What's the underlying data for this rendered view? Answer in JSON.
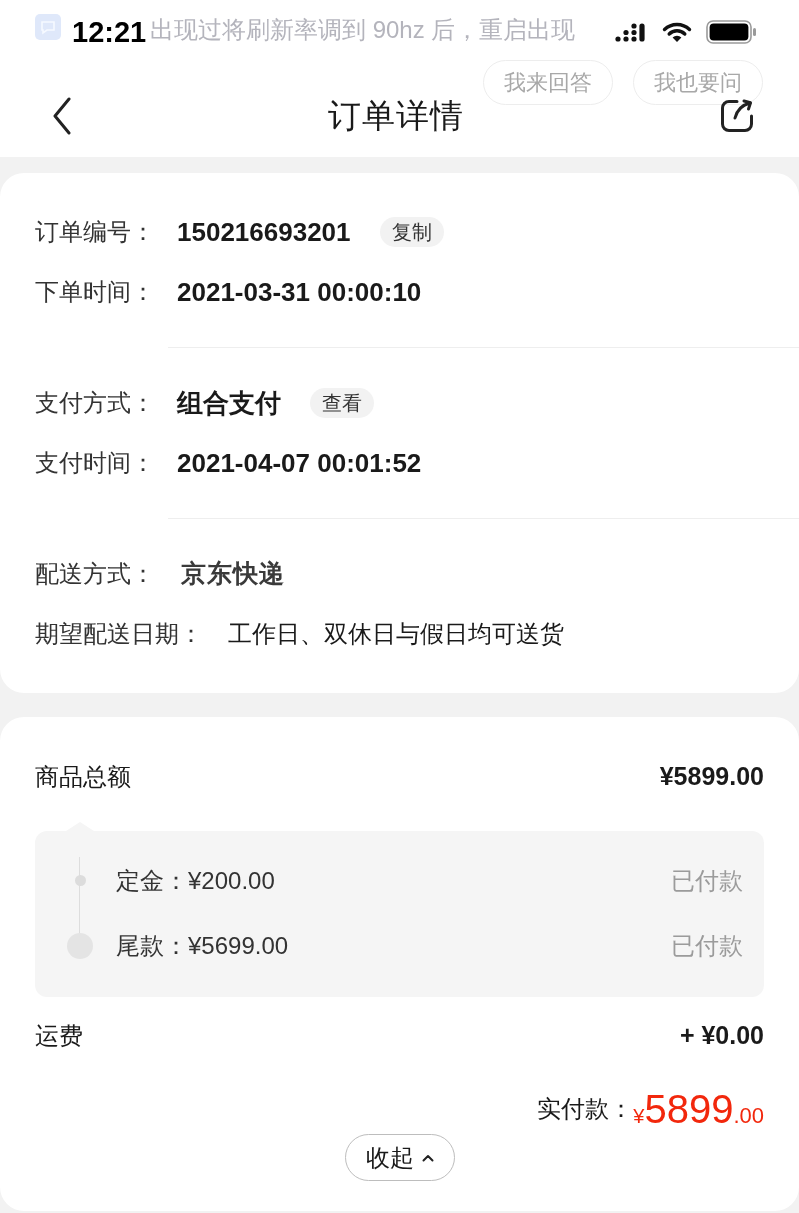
{
  "status_bar": {
    "time": "12:21"
  },
  "background_layer": {
    "notification": "出现过将刷新率调到 90hz 后，重启出现",
    "buttons": [
      "我来回答",
      "我也要问"
    ]
  },
  "nav_bar": {
    "title": "订单详情"
  },
  "order_card": {
    "groups": [
      {
        "rows": [
          {
            "label": "订单编号：",
            "value": "150216693201",
            "kind": "emphasis",
            "action": "复制"
          },
          {
            "label": "下单时间：",
            "value": "2021-03-31 00:00:10",
            "kind": "emphasis"
          }
        ]
      },
      {
        "rows": [
          {
            "label": "支付方式：",
            "value": "组合支付",
            "kind": "emphasis",
            "action": "查看"
          },
          {
            "label": "支付时间：",
            "value": "2021-04-07 00:01:52",
            "kind": "emphasis"
          }
        ]
      },
      {
        "rows": [
          {
            "label": "配送方式：",
            "value": "京东快递",
            "kind": "logo"
          },
          {
            "label": "期望配送日期：",
            "value": "工作日、双休日与假日均可送货",
            "kind": "plain"
          }
        ]
      }
    ]
  },
  "price_card": {
    "subtotal": {
      "label": "商品总额",
      "value": "¥5899.00"
    },
    "installments": [
      {
        "label": "定金：¥200.00",
        "status": "已付款",
        "kind": "step"
      },
      {
        "label": "尾款：¥5699.00",
        "status": "已付款",
        "kind": "last"
      }
    ],
    "shipping": {
      "label": "运费",
      "value": "+ ¥0.00"
    },
    "total": {
      "label": "实付款：",
      "currency": "¥",
      "integer": "5899",
      "decimal": ".00"
    },
    "collapse_button": {
      "label": "收起"
    }
  }
}
